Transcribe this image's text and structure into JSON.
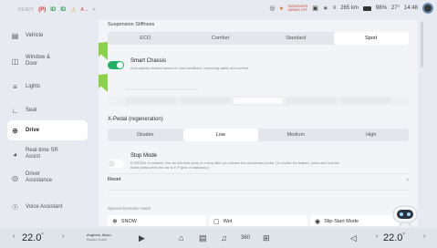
{
  "status": {
    "ready": "READY",
    "indicators": [
      "(P)",
      "ID",
      "ID"
    ],
    "mode_icons": [
      "A→",
      "≈"
    ],
    "airbag_line1": "PASSENGER",
    "airbag_line2": "AIRBAG OFF",
    "range": "265 km",
    "battery": "98%",
    "outside_temp": "27°",
    "time": "14:48"
  },
  "sidebar": {
    "items": [
      {
        "label": "Vehicle",
        "icon": "car-icon"
      },
      {
        "label": "Window & Door",
        "icon": "window-icon"
      },
      {
        "label": "Lights",
        "icon": "light-icon"
      },
      {
        "label": "Seat",
        "icon": "seat-icon"
      },
      {
        "label": "Drive",
        "icon": "steering-wheel-icon"
      },
      {
        "label": "Real-time SR Assist",
        "icon": "radar-icon"
      },
      {
        "label": "Driver Assistance",
        "icon": "assist-icon"
      },
      {
        "label": "Voice Assistant",
        "icon": "voice-icon"
      }
    ]
  },
  "suspension": {
    "title": "Suspension Stiffness",
    "options": [
      "ECO",
      "Comfort",
      "Standard",
      "Sport"
    ],
    "selected": "Sport"
  },
  "smart_chassis": {
    "title": "Smart Chassis",
    "desc": "Auto-adjusts chassis based on road conditions, improving safety and comfort",
    "enabled": true
  },
  "xpedal": {
    "title": "X-Pedal (regeneration)",
    "options": [
      "Disable",
      "Low",
      "Medium",
      "High"
    ],
    "selected": "Low"
  },
  "stop_mode": {
    "title": "Stop Mode",
    "desc1": "If XPEDAL is enabled, the car will slow down to a stop after you release the accelerator pedal. (To enable the feature, press and hold the",
    "desc2": "brake pedal when the car is in P gear or stationary)",
    "enabled": false
  },
  "reset": {
    "label": "Reset"
  },
  "scenarios": {
    "title": "Special Scenario Assist",
    "items": [
      "SNOW",
      "Wet",
      "Slip-Start Mode"
    ]
  },
  "bottom": {
    "temp_left": "22.0",
    "temp_right": "22.0",
    "deg": "°",
    "media_line1": "Anghela, Aiiym.",
    "media_line2": "Bautur Kuzh",
    "fan": "360"
  },
  "colors": {
    "accent_green": "#22b067",
    "arrow_green": "#8bd14a"
  }
}
